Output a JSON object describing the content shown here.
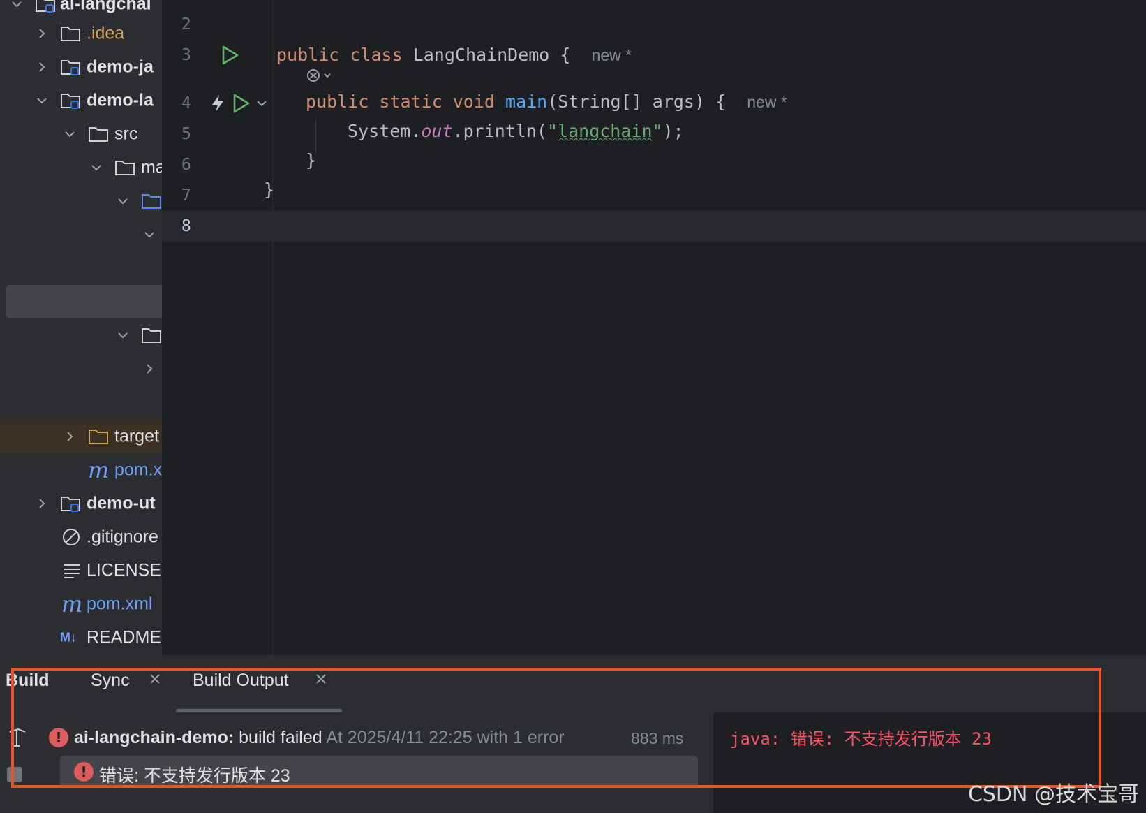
{
  "project_tree": {
    "root_label": "ai-langchai",
    "items": [
      {
        "label": ".idea",
        "icon": "folder-icon"
      },
      {
        "label": "demo-ja",
        "icon": "module-folder-icon"
      },
      {
        "label": "demo-la",
        "icon": "module-folder-icon"
      },
      {
        "label": "src",
        "icon": "folder-icon"
      },
      {
        "label": "ma",
        "icon": "folder-icon"
      },
      {
        "label": "target",
        "icon": "folder-icon"
      },
      {
        "label": "pom.x",
        "icon": "maven-icon"
      },
      {
        "label": "demo-ut",
        "icon": "module-folder-icon"
      },
      {
        "label": ".gitignore",
        "icon": "ignore-icon"
      },
      {
        "label": "LICENSE",
        "icon": "text-file-icon"
      },
      {
        "label": "pom.xml",
        "icon": "maven-icon"
      },
      {
        "label": "README",
        "icon": "markdown-icon"
      }
    ]
  },
  "editor": {
    "line_numbers": [
      "2",
      "3",
      "4",
      "5",
      "6",
      "7",
      "8"
    ],
    "line3": {
      "kw1": "public",
      "kw2": "class",
      "name": " LangChainDemo {",
      "hint": "new *"
    },
    "line4": {
      "kw1": "public",
      "kw2": "static",
      "kw3": "void",
      "fn": "main",
      "rest": "(String[] args) {",
      "hint": "new *"
    },
    "line5": {
      "obj": "System.",
      "field": "out",
      "call": ".println(",
      "str_open": "\"",
      "str_text": "langchain",
      "str_close": "\"",
      "end": ");"
    },
    "line6": "}",
    "line7": "}"
  },
  "build": {
    "title": "Build",
    "tabs": [
      {
        "label": "Sync"
      },
      {
        "label": "Build Output"
      }
    ],
    "result": {
      "project": "ai-langchain-demo:",
      "status": " build failed",
      "detail": " At 2025/4/11 22:25 with 1 error",
      "duration": "883 ms"
    },
    "error_item": "错误: 不支持发行版本 23",
    "output_text": "java: 错误: 不支持发行版本 23"
  },
  "watermark": "CSDN @技术宝哥",
  "colors": {
    "error": "#db5c5c",
    "highlight_box": "#e0562f",
    "keyword": "#cf8e6d",
    "string": "#6aab73"
  }
}
